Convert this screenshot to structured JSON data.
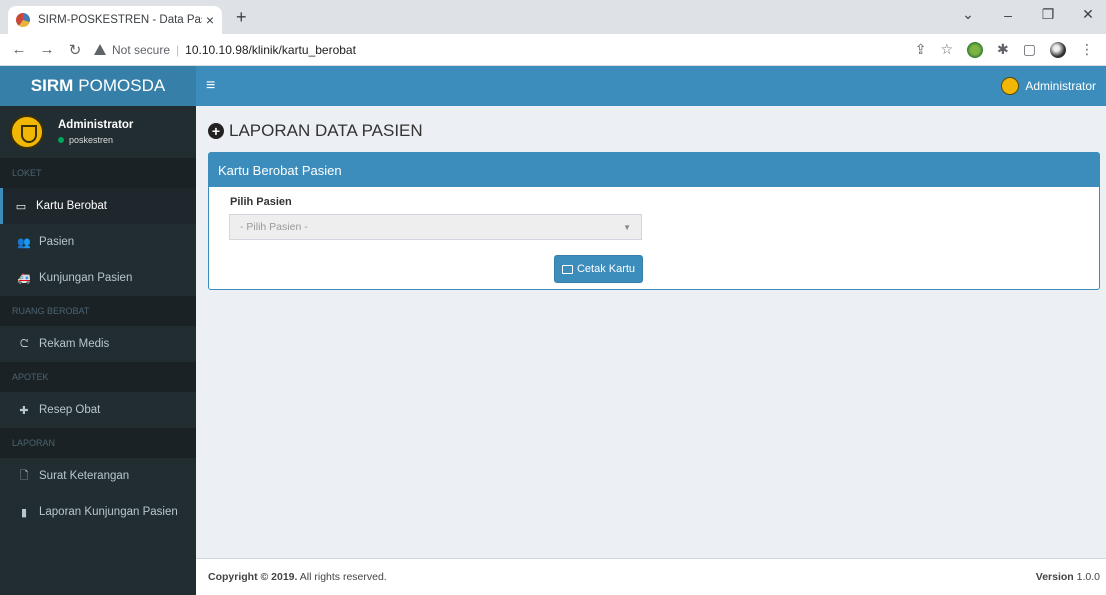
{
  "browser": {
    "tab_title": "SIRM-POSKESTREN - Data Pasien",
    "tab_close": "×",
    "new_tab": "+",
    "url_warning": "Not secure",
    "url_separator": "|",
    "url": "10.10.10.98/klinik/kartu_berobat"
  },
  "header": {
    "brand_bold": "SIRM",
    "brand_rest": "POMOSDA",
    "menu_icon": "≡",
    "user_name": "Administrator"
  },
  "sidebar": {
    "user_name": "Administrator",
    "user_status": "poskestren",
    "sections": [
      {
        "title": "LOKET",
        "items": [
          "Kartu Berobat",
          "Pasien",
          "Kunjungan Pasien"
        ]
      },
      {
        "title": "RUANG BEROBAT",
        "items": [
          "Rekam Medis"
        ]
      },
      {
        "title": "APOTEK",
        "items": [
          "Resep Obat"
        ]
      },
      {
        "title": "LAPORAN",
        "items": [
          "Surat Keterangan",
          "Laporan Kunjungan Pasien"
        ]
      }
    ]
  },
  "main": {
    "page_title": "LAPORAN DATA PASIEN",
    "box_title": "Kartu Berobat Pasien",
    "field_label": "Pilih Pasien",
    "select_placeholder": "- Pilih Pasien -",
    "print_button": "Cetak Kartu"
  },
  "footer": {
    "copyright_bold": "Copyright © 2019.",
    "copyright_rest": "All rights reserved.",
    "version_label": "Version",
    "version_value": "1.0.0"
  },
  "colors": {
    "primary": "#3c8dbc",
    "logo_bg": "#367fa9",
    "sidebar_bg": "#222d32"
  }
}
